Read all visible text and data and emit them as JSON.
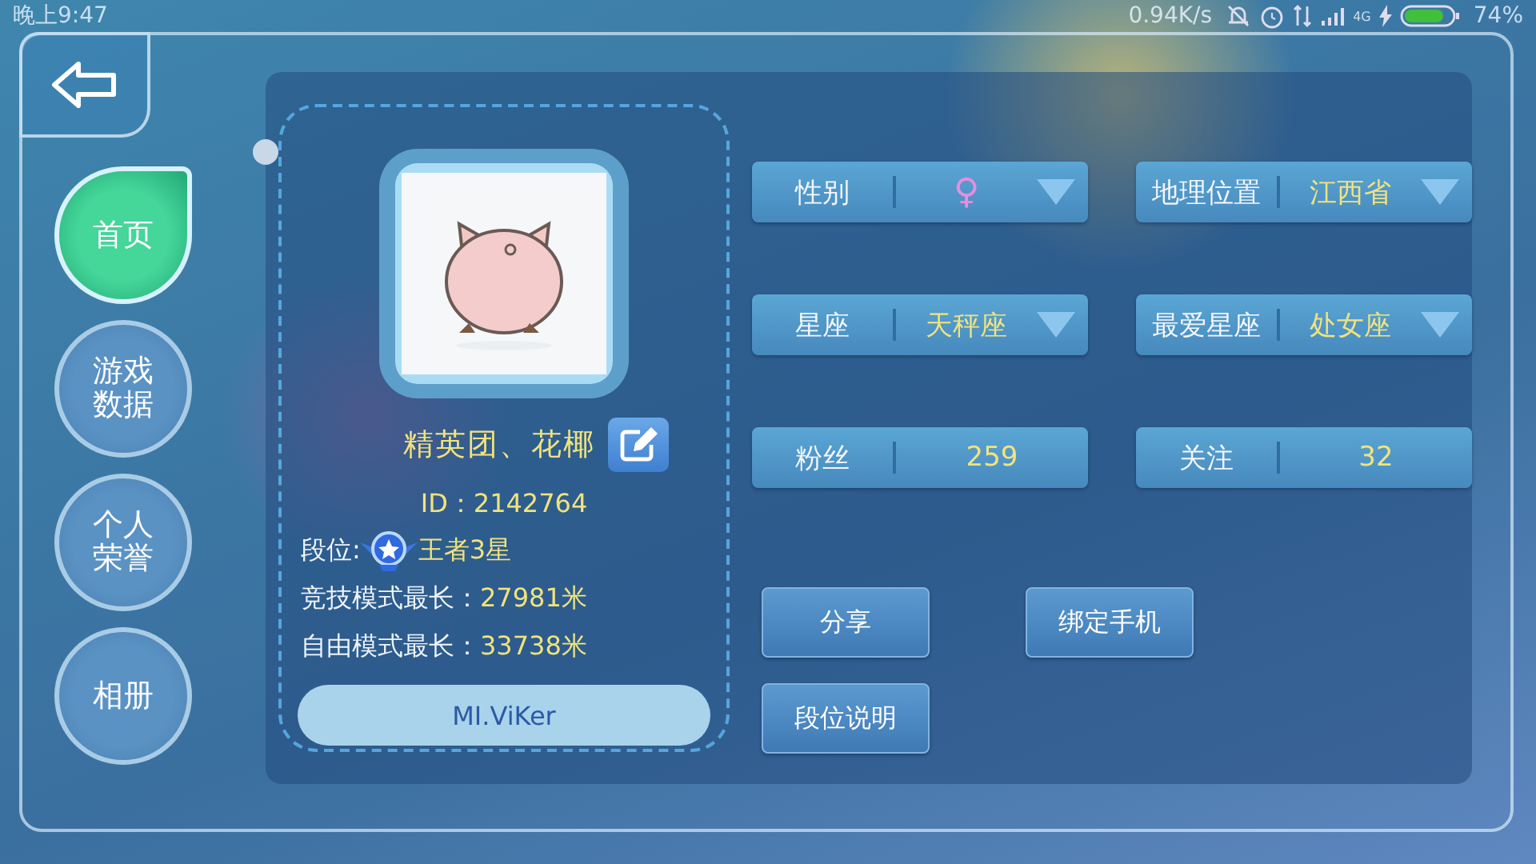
{
  "status_bar": {
    "time": "晚上9:47",
    "speed": "0.94K/s",
    "network": "4G",
    "battery": "74%"
  },
  "nav": [
    {
      "label": "首页",
      "selected": true
    },
    {
      "label": "游戏数据",
      "selected": false
    },
    {
      "label": "个人荣誉",
      "selected": false
    },
    {
      "label": "相册",
      "selected": false
    }
  ],
  "profile": {
    "nickname": "精英团、花椰",
    "id": "ID：2142764",
    "rank_label": "段位:",
    "rank": "王者3星",
    "stats": [
      {
        "label": "竞技模式最长：",
        "value": "27981米"
      },
      {
        "label": "自由模式最长：",
        "value": "33738米"
      }
    ],
    "username": "MI.ViKer"
  },
  "fields": [
    {
      "label": "性别",
      "value": "♀",
      "kind": "gender"
    },
    {
      "label": "地理位置",
      "value": "江西省",
      "kind": "dropdown"
    },
    {
      "label": "星座",
      "value": "天秤座",
      "kind": "dropdown"
    },
    {
      "label": "最爱星座",
      "value": "处女座",
      "kind": "dropdown"
    },
    {
      "label": "粉丝",
      "value": "259",
      "kind": "count"
    },
    {
      "label": "关注",
      "value": "32",
      "kind": "count"
    }
  ],
  "buttons": [
    "分享",
    "绑定手机",
    "段位说明"
  ]
}
